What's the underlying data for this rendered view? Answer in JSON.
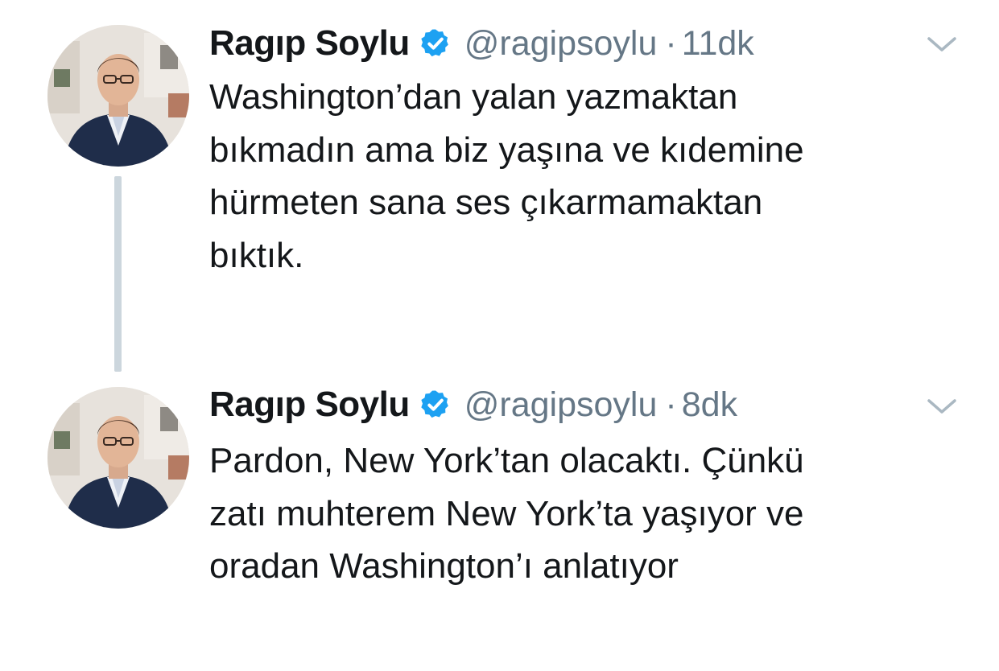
{
  "tweets": [
    {
      "display_name": "Ragıp Soylu",
      "handle": "@ragipsoylu",
      "separator": "·",
      "time": "11dk",
      "verified": true,
      "text_lines": [
        "Washington’dan yalan yazmaktan",
        "bıkmadın ama biz yaşına ve kıdemine",
        "hürmeten sana ses çıkarmamaktan",
        "bıktık."
      ]
    },
    {
      "display_name": "Ragıp Soylu",
      "handle": "@ragipsoylu",
      "separator": "·",
      "time": "8dk",
      "verified": true,
      "text_lines": [
        "Pardon, New York’tan olacaktı. Çünkü",
        "zatı muhterem New York’ta yaşıyor ve",
        "oradan Washington’ı anlatıyor"
      ]
    }
  ],
  "colors": {
    "text": "#14171a",
    "secondary": "#657786",
    "verified_badge": "#1da1f2",
    "thread_line": "#ccd6dd",
    "chevron": "#aab8c2"
  },
  "icons": {
    "verified": "verified-badge-icon",
    "menu": "chevron-down-icon"
  }
}
